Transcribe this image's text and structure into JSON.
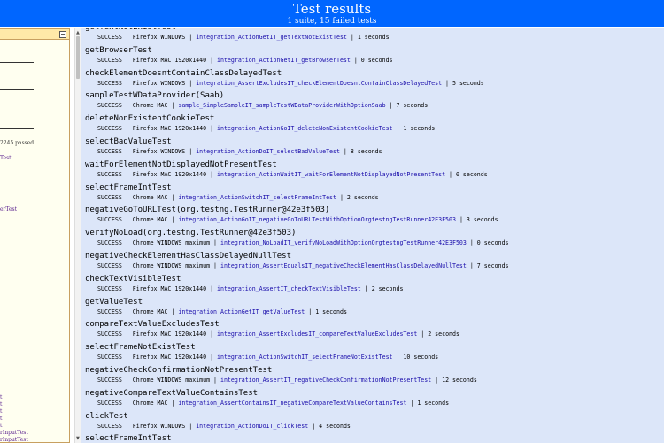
{
  "header": {
    "title": "Test results",
    "subtitle": "1 suite, 15 failed tests"
  },
  "sidebar": {
    "collapse_glyph": "−",
    "passed_text": "2245 passed",
    "links_top": [
      "Test",
      "erTest"
    ],
    "links_bottom": [
      "t",
      "t",
      "t",
      "t",
      "t",
      "rInputTest",
      "rInputTest"
    ]
  },
  "scrollbar": {
    "up": "▲",
    "down": "▼"
  },
  "results": [
    {
      "method": "getTextNotExistTest",
      "status": "SUCCESS",
      "browser": "Firefox WINDOWS",
      "class": "integration_ActionGetIT_getTextNotExistTest",
      "time": "1 seconds"
    },
    {
      "method": "getBrowserTest",
      "status": "SUCCESS",
      "browser": "Firefox MAC 1920x1440",
      "class": "integration_ActionGetIT_getBrowserTest",
      "time": "0 seconds"
    },
    {
      "method": "checkElementDoesntContainClassDelayedTest",
      "status": "SUCCESS",
      "browser": "Firefox WINDOWS",
      "class": "integration_AssertExcludesIT_checkElementDoesntContainClassDelayedTest",
      "time": "5 seconds"
    },
    {
      "method": "sampleTestWDataProvider(Saab)",
      "status": "SUCCESS",
      "browser": "Chrome MAC",
      "class": "sample_SimpleSampleIT_sampleTestWDataProviderWithOptionSaab",
      "time": "7 seconds"
    },
    {
      "method": "deleteNonExistentCookieTest",
      "status": "SUCCESS",
      "browser": "Firefox MAC 1920x1440",
      "class": "integration_ActionGoIT_deleteNonExistentCookieTest",
      "time": "1 seconds"
    },
    {
      "method": "selectBadValueTest",
      "status": "SUCCESS",
      "browser": "Firefox WINDOWS",
      "class": "integration_ActionDoIT_selectBadValueTest",
      "time": "8 seconds"
    },
    {
      "method": "waitForElementNotDisplayedNotPresentTest",
      "status": "SUCCESS",
      "browser": "Firefox MAC 1920x1440",
      "class": "integration_ActionWaitIT_waitForElementNotDisplayedNotPresentTest",
      "time": "0 seconds"
    },
    {
      "method": "selectFrameIntTest",
      "status": "SUCCESS",
      "browser": "Chrome MAC",
      "class": "integration_ActionSwitchIT_selectFrameIntTest",
      "time": "2 seconds"
    },
    {
      "method": "negativeGoToURLTest(org.testng.TestRunner@42e3f503)",
      "status": "SUCCESS",
      "browser": "Chrome MAC",
      "class": "integration_ActionGoIT_negativeGoToURLTestWithOptionOrgtestngTestRunner42E3F503",
      "time": "3 seconds"
    },
    {
      "method": "verifyNoLoad(org.testng.TestRunner@42e3f503)",
      "status": "SUCCESS",
      "browser": "Chrome WINDOWS maximum",
      "class": "integration_NoLoadIT_verifyNoLoadWithOptionOrgtestngTestRunner42E3F503",
      "time": "0 seconds"
    },
    {
      "method": "negativeCheckElementHasClassDelayedNullTest",
      "status": "SUCCESS",
      "browser": "Chrome WINDOWS maximum",
      "class": "integration_AssertEqualsIT_negativeCheckElementHasClassDelayedNullTest",
      "time": "7 seconds"
    },
    {
      "method": "checkTextVisibleTest",
      "status": "SUCCESS",
      "browser": "Firefox MAC 1920x1440",
      "class": "integration_AssertIT_checkTextVisibleTest",
      "time": "2 seconds"
    },
    {
      "method": "getValueTest",
      "status": "SUCCESS",
      "browser": "Chrome MAC",
      "class": "integration_ActionGetIT_getValueTest",
      "time": "1 seconds"
    },
    {
      "method": "compareTextValueExcludesTest",
      "status": "SUCCESS",
      "browser": "Firefox MAC 1920x1440",
      "class": "integration_AssertExcludesIT_compareTextValueExcludesTest",
      "time": "2 seconds"
    },
    {
      "method": "selectFrameNotExistTest",
      "status": "SUCCESS",
      "browser": "Firefox MAC 1920x1440",
      "class": "integration_ActionSwitchIT_selectFrameNotExistTest",
      "time": "10 seconds"
    },
    {
      "method": "negativeCheckConfirmationNotPresentTest",
      "status": "SUCCESS",
      "browser": "Chrome WINDOWS maximum",
      "class": "integration_AssertIT_negativeCheckConfirmationNotPresentTest",
      "time": "12 seconds"
    },
    {
      "method": "negativeCompareTextValueContainsTest",
      "status": "SUCCESS",
      "browser": "Chrome MAC",
      "class": "integration_AssertContainsIT_negativeCompareTextValueContainsTest",
      "time": "1 seconds"
    },
    {
      "method": "clickTest",
      "status": "SUCCESS",
      "browser": "Firefox WINDOWS",
      "class": "integration_ActionDoIT_clickTest",
      "time": "4 seconds"
    },
    {
      "method": "selectFrameIntTest",
      "status": "",
      "browser": "",
      "class": "",
      "time": ""
    }
  ]
}
